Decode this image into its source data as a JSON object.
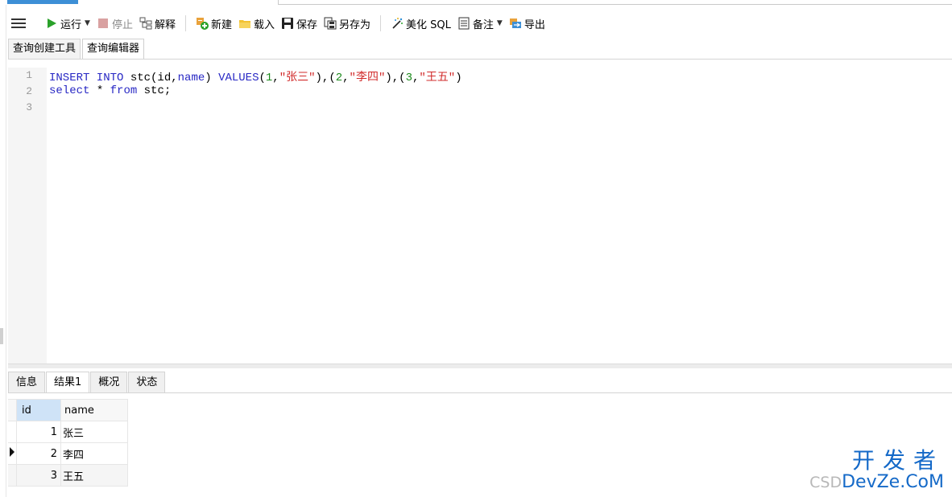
{
  "toolbar": {
    "run": "运行",
    "stop": "停止",
    "explain": "解释",
    "new": "新建",
    "load": "载入",
    "save": "保存",
    "save_as": "另存为",
    "beautify": "美化 SQL",
    "note": "备注",
    "export": "导出"
  },
  "top_tabs": [
    "查询创建工具",
    "查询编辑器"
  ],
  "editor": {
    "line_numbers": [
      "1",
      "2",
      "3"
    ],
    "line1": {
      "insert": "INSERT INTO",
      "table": " stc(id,",
      "col": "name",
      "close": ") ",
      "values": "VALUES",
      "p1": "(",
      "n1": "1",
      "c1": ",",
      "s1": "\"张三\"",
      "p2": "),(",
      "n2": "2",
      "c2": ",",
      "s2": "\"李四\"",
      "p3": "),(",
      "n3": "3",
      "c3": ",",
      "s3": "\"王五\"",
      "p4": ")"
    },
    "line2": {
      "select": "select",
      "star": " * ",
      "from": "from",
      "rest": " stc;"
    }
  },
  "bottom_tabs": [
    "信息",
    "结果1",
    "概况",
    "状态"
  ],
  "result": {
    "columns": [
      "id",
      "name"
    ],
    "rows": [
      {
        "id": "1",
        "name": "张三"
      },
      {
        "id": "2",
        "name": "李四"
      },
      {
        "id": "3",
        "name": "王五"
      }
    ]
  },
  "watermark": {
    "cn": "开发者",
    "prefix": "CSD",
    "en": "DevZe.CoM"
  },
  "colors": {
    "keyword": "#2727c4",
    "number": "#1a8a1a",
    "string": "#d12b2b",
    "watermark": "#1469c8",
    "header_selected": "#cfe3f7"
  },
  "icons": [
    "menu-icon",
    "run-icon",
    "stop-icon",
    "explain-icon",
    "new-icon",
    "load-icon",
    "save-icon",
    "save-as-icon",
    "beautify-icon",
    "note-icon",
    "export-icon",
    "row-pointer-icon"
  ]
}
